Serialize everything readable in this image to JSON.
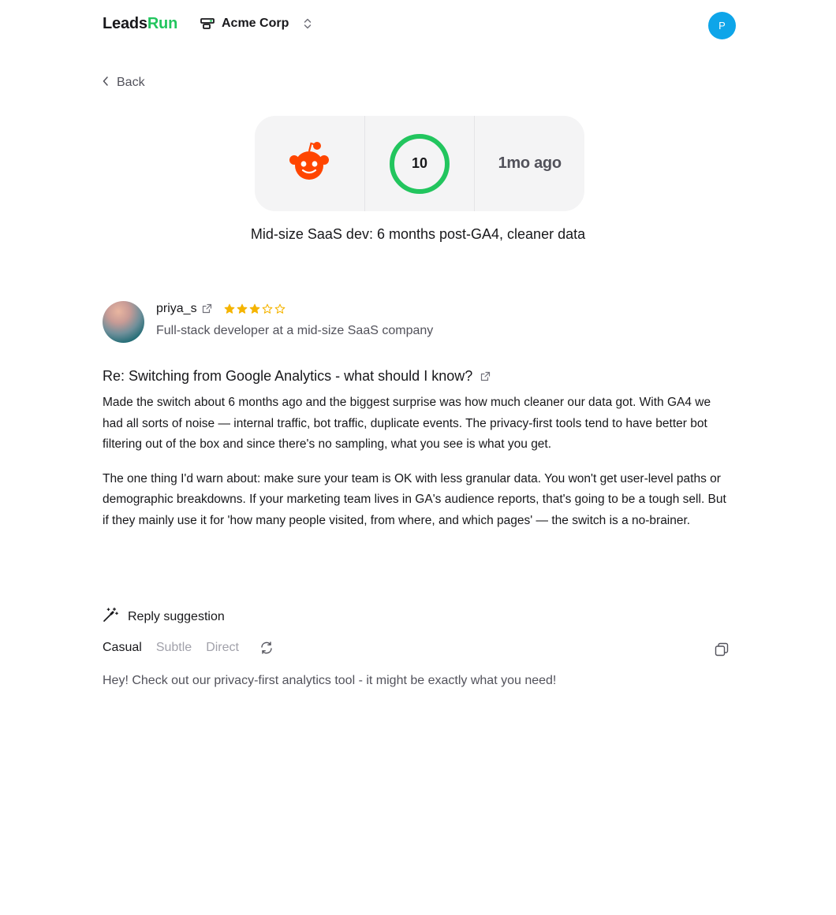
{
  "header": {
    "logo_part1": "Leads",
    "logo_part2": "Run",
    "org_name": "Acme Corp",
    "user_initial": "P"
  },
  "nav": {
    "back_label": "Back"
  },
  "lead": {
    "platform": "reddit",
    "score": "10",
    "time_ago": "1mo ago",
    "title": "Mid-size SaaS dev: 6 months post-GA4, cleaner data"
  },
  "author": {
    "name": "priya_s",
    "rating": 3,
    "rating_max": 5,
    "bio": "Full-stack developer at a mid-size SaaS company"
  },
  "comment": {
    "title": "Re: Switching from Google Analytics - what should I know?",
    "paragraphs": [
      "Made the switch about 6 months ago and the biggest surprise was how much cleaner our data got. With GA4 we had all sorts of noise — internal traffic, bot traffic, duplicate events. The privacy-first tools tend to have better bot filtering out of the box and since there's no sampling, what you see is what you get.",
      "The one thing I'd warn about: make sure your team is OK with less granular data. You won't get user-level paths or demographic breakdowns. If your marketing team lives in GA's audience reports, that's going to be a tough sell. But if they mainly use it for 'how many people visited, from where, and which pages' — the switch is a no-brainer."
    ]
  },
  "reply": {
    "heading": "Reply suggestion",
    "tabs": [
      {
        "label": "Casual",
        "active": true
      },
      {
        "label": "Subtle",
        "active": false
      },
      {
        "label": "Direct",
        "active": false
      }
    ],
    "text": "Hey! Check out our privacy-first analytics tool - it might be exactly what you need!"
  },
  "colors": {
    "brand_green": "#22c55e",
    "reddit_orange": "#ff4500",
    "star_yellow": "#f5b400",
    "avatar_blue": "#0ea5e9"
  },
  "icons": [
    "org-icon",
    "chevron-updown-icon",
    "chevron-left-icon",
    "reddit-icon",
    "external-link-icon",
    "star-icon",
    "magic-wand-icon",
    "refresh-icon",
    "copy-icon"
  ]
}
